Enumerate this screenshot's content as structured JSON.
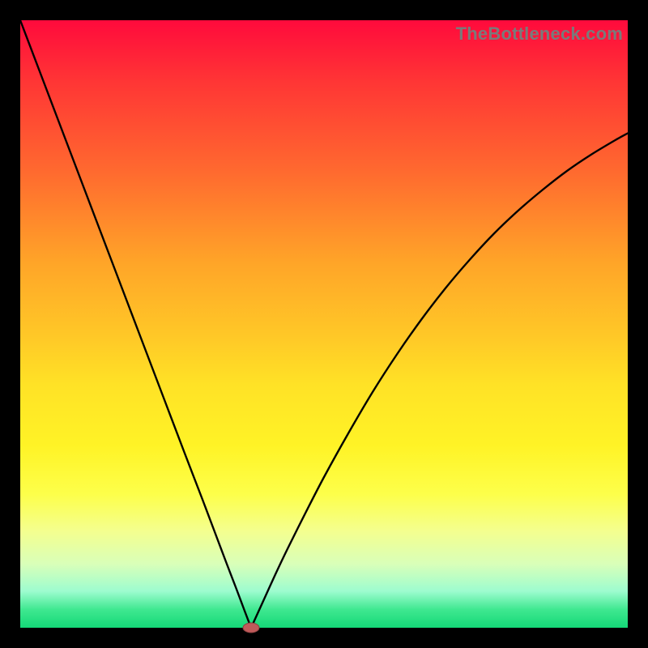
{
  "watermark": "TheBottleneck.com",
  "colors": {
    "frame": "#000000",
    "curve": "#000000",
    "marker_fill": "#c05a5a",
    "marker_stroke": "#8a3f3f"
  },
  "chart_data": {
    "type": "line",
    "title": "",
    "xlabel": "",
    "ylabel": "",
    "xlim": [
      0,
      100
    ],
    "ylim": [
      0,
      100
    ],
    "grid": false,
    "legend": false,
    "x": [
      0,
      3,
      6,
      9,
      12,
      15,
      18,
      21,
      24,
      27,
      30,
      32,
      34,
      35.5,
      37,
      38,
      40,
      42,
      44,
      47,
      50,
      54,
      58,
      62,
      66,
      70,
      74,
      78,
      82,
      86,
      90,
      94,
      98,
      100
    ],
    "y": [
      100,
      92.1,
      84.2,
      76.3,
      68.4,
      60.5,
      52.6,
      44.7,
      36.8,
      28.9,
      21.1,
      15.8,
      10.5,
      6.6,
      2.6,
      0,
      4.4,
      8.8,
      13.0,
      19.0,
      24.8,
      32.0,
      38.8,
      45.0,
      50.7,
      55.9,
      60.6,
      64.9,
      68.7,
      72.1,
      75.2,
      77.9,
      80.3,
      81.4
    ],
    "marker_point": {
      "x": 38,
      "y": 0
    }
  }
}
